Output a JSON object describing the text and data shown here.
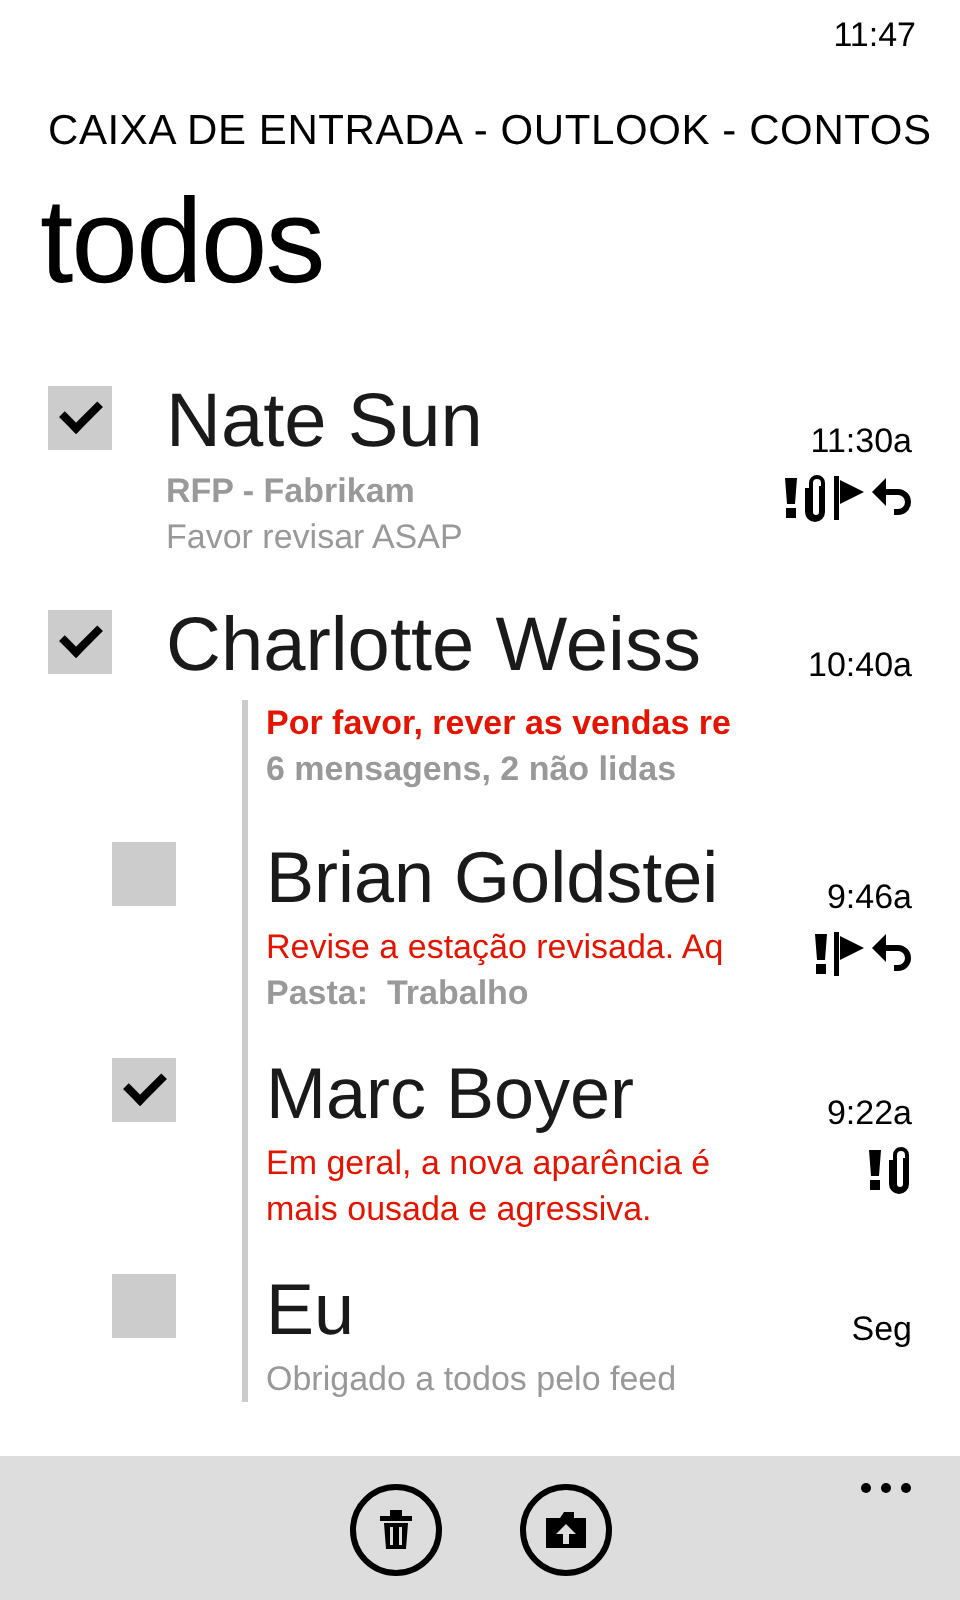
{
  "status_bar": {
    "time": "11:47"
  },
  "header": {
    "account": "CAIXA DE ENTRADA - OUTLOOK - CONTOS",
    "title": "todos"
  },
  "messages": [
    {
      "name": "Nate Sun",
      "time": "11:30a",
      "checked": true,
      "unread": false,
      "icons": [
        {
          "kind": "important"
        },
        {
          "kind": "attachment"
        },
        {
          "kind": "flag"
        },
        {
          "kind": "replied"
        }
      ],
      "lines": [
        {
          "kind": "subject",
          "text": "RFP - Fabrikam"
        },
        {
          "kind": "preview",
          "text": "Favor revisar ASAP"
        }
      ]
    },
    {
      "name": "Charlotte Weiss",
      "time": "10:40a",
      "checked": true,
      "unread": true,
      "lines": [
        {
          "kind": "subject",
          "text": "Por favor, rever as vendas re"
        },
        {
          "kind": "count",
          "text": "6 mensagens, 2 não lidas"
        }
      ],
      "children": [
        {
          "name": "Brian Goldstei",
          "time": "9:46a",
          "checked": false,
          "unread": true,
          "icons": [
            {
              "kind": "important"
            },
            {
              "kind": "flag"
            },
            {
              "kind": "replied"
            }
          ],
          "lines": [
            {
              "kind": "preview",
              "text": "Revise a estação revisada. Aq"
            },
            {
              "kind": "folder",
              "text": "Pasta:  Trabalho"
            }
          ]
        },
        {
          "name": "Marc Boyer",
          "time": "9:22a",
          "checked": true,
          "unread": true,
          "icons": [
            {
              "kind": "important"
            },
            {
              "kind": "attachment"
            }
          ],
          "lines": [
            {
              "kind": "preview",
              "text": "Em geral, a nova aparência é mais ousada e agressiva."
            }
          ]
        },
        {
          "name": "Eu",
          "time": "Seg",
          "checked": false,
          "unread": false,
          "lines": [
            {
              "kind": "preview",
              "text": "Obrigado a todos pelo feed"
            }
          ]
        }
      ]
    }
  ],
  "app_bar": {
    "buttons": [
      {
        "kind": "delete"
      },
      {
        "kind": "move"
      }
    ]
  }
}
